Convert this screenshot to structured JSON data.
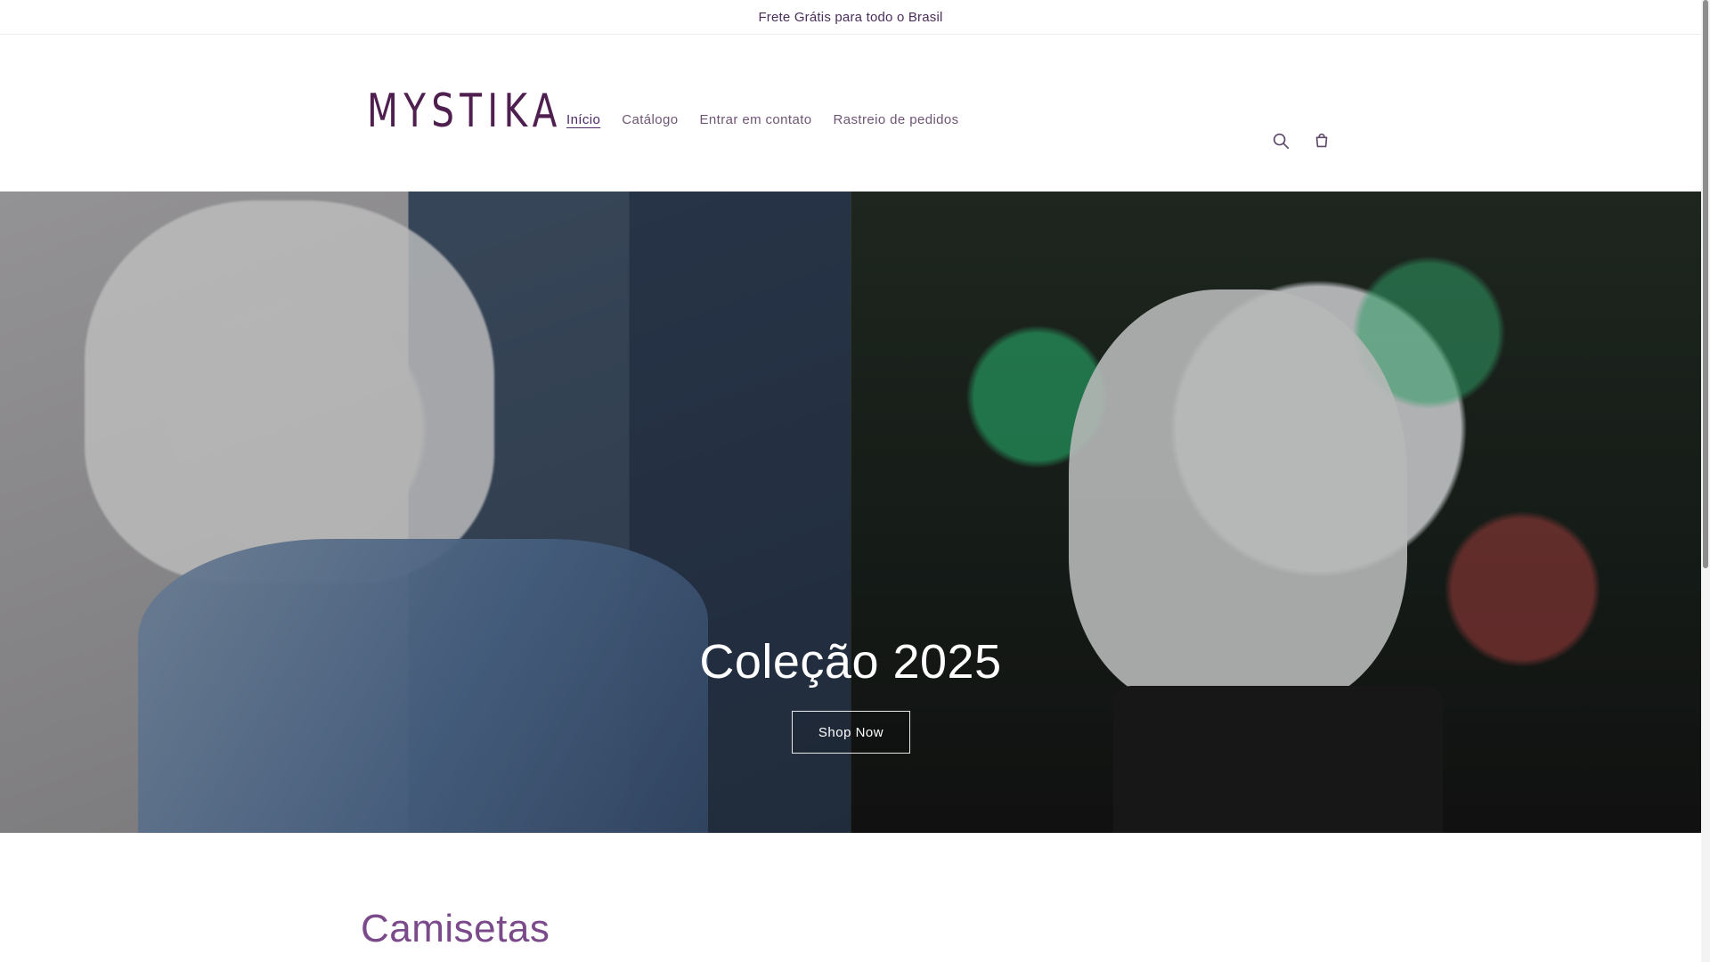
{
  "announcement": {
    "text": "Frete Grátis para todo o Brasil"
  },
  "header": {
    "logo_text": "MYSTIKA",
    "nav": [
      {
        "label": "Início",
        "active": true
      },
      {
        "label": "Catálogo",
        "active": false
      },
      {
        "label": "Entrar em contato",
        "active": false
      },
      {
        "label": "Rastreio de pedidos",
        "active": false
      }
    ],
    "icons": {
      "search": "search-icon",
      "cart": "cart-icon"
    }
  },
  "hero": {
    "title": "Coleção 2025",
    "button_label": "Shop Now"
  },
  "section": {
    "title": "Camisetas"
  },
  "colors": {
    "brand": "#4e1f4f",
    "nav_text": "#6f5575",
    "section_title": "#7b4a8a",
    "hero_overlay": "rgba(0,0,0,0.26)"
  }
}
